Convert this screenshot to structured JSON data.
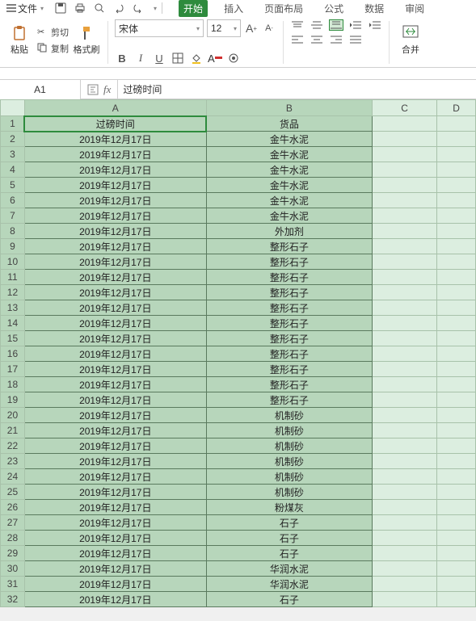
{
  "menu": {
    "file": "文件",
    "tabs": [
      "开始",
      "插入",
      "页面布局",
      "公式",
      "数据",
      "审阅"
    ],
    "active_tab_index": 0
  },
  "ribbon": {
    "paste": "粘贴",
    "cut": "剪切",
    "copy": "复制",
    "format_painter": "格式刷",
    "font_name": "宋体",
    "font_size": "12",
    "merge": "合并"
  },
  "namebox": "A1",
  "formula_value": "过磅时间",
  "columns": [
    "A",
    "B",
    "C",
    "D"
  ],
  "chart_data": {
    "type": "table",
    "headers": [
      "过磅时间",
      "货品"
    ],
    "rows": [
      [
        "2019年12月17日",
        "金牛水泥"
      ],
      [
        "2019年12月17日",
        "金牛水泥"
      ],
      [
        "2019年12月17日",
        "金牛水泥"
      ],
      [
        "2019年12月17日",
        "金牛水泥"
      ],
      [
        "2019年12月17日",
        "金牛水泥"
      ],
      [
        "2019年12月17日",
        "金牛水泥"
      ],
      [
        "2019年12月17日",
        "外加剂"
      ],
      [
        "2019年12月17日",
        "整形石子"
      ],
      [
        "2019年12月17日",
        "整形石子"
      ],
      [
        "2019年12月17日",
        "整形石子"
      ],
      [
        "2019年12月17日",
        "整形石子"
      ],
      [
        "2019年12月17日",
        "整形石子"
      ],
      [
        "2019年12月17日",
        "整形石子"
      ],
      [
        "2019年12月17日",
        "整形石子"
      ],
      [
        "2019年12月17日",
        "整形石子"
      ],
      [
        "2019年12月17日",
        "整形石子"
      ],
      [
        "2019年12月17日",
        "整形石子"
      ],
      [
        "2019年12月17日",
        "整形石子"
      ],
      [
        "2019年12月17日",
        "机制砂"
      ],
      [
        "2019年12月17日",
        "机制砂"
      ],
      [
        "2019年12月17日",
        "机制砂"
      ],
      [
        "2019年12月17日",
        "机制砂"
      ],
      [
        "2019年12月17日",
        "机制砂"
      ],
      [
        "2019年12月17日",
        "机制砂"
      ],
      [
        "2019年12月17日",
        "粉煤灰"
      ],
      [
        "2019年12月17日",
        "石子"
      ],
      [
        "2019年12月17日",
        "石子"
      ],
      [
        "2019年12月17日",
        "石子"
      ],
      [
        "2019年12月17日",
        "华润水泥"
      ],
      [
        "2019年12月17日",
        "华润水泥"
      ],
      [
        "2019年12月17日",
        "石子"
      ]
    ]
  }
}
